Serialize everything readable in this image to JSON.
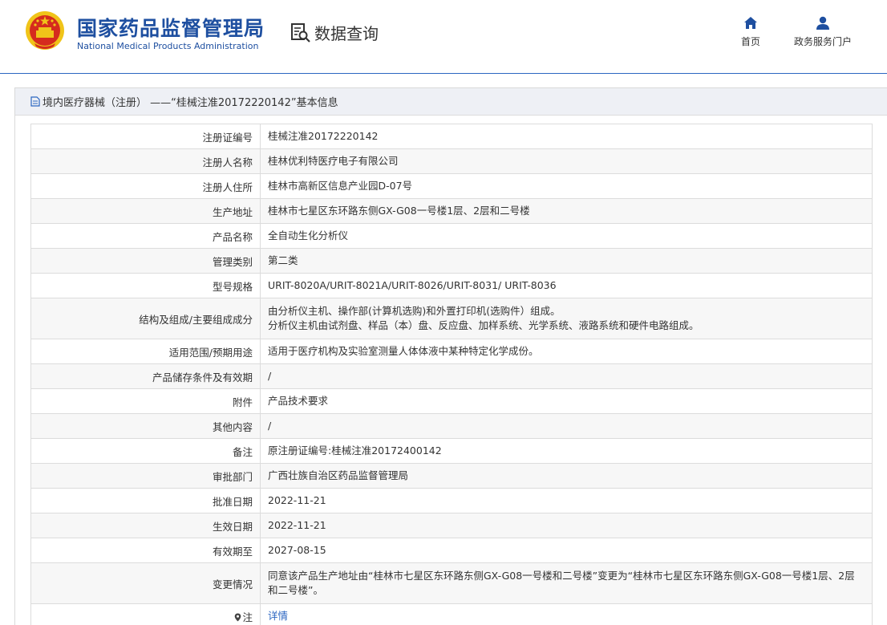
{
  "header": {
    "brand_cn": "国家药品监督管理局",
    "brand_en": "National Medical Products Administration",
    "query_label": "数据查询",
    "nav_home": "首页",
    "nav_portal": "政务服务门户"
  },
  "colors": {
    "brand": "#1e4fa0",
    "accent": "#2b66c1",
    "emblem_red": "#d52b1e",
    "emblem_gold": "#f0c419"
  },
  "panel": {
    "title": "境内医疗器械（注册） ——“桂械注准20172220142”基本信息"
  },
  "rows": [
    {
      "label": "注册证编号",
      "value": "桂械注准20172220142"
    },
    {
      "label": "注册人名称",
      "value": "桂林优利特医疗电子有限公司"
    },
    {
      "label": "注册人住所",
      "value": "桂林市高新区信息产业园D-07号"
    },
    {
      "label": "生产地址",
      "value": "桂林市七星区东环路东侧GX-G08一号楼1层、2层和二号楼"
    },
    {
      "label": "产品名称",
      "value": "全自动生化分析仪"
    },
    {
      "label": "管理类别",
      "value": "第二类"
    },
    {
      "label": "型号规格",
      "value": "URIT-8020A/URIT-8021A/URIT-8026/URIT-8031/ URIT-8036"
    },
    {
      "label": "结构及组成/主要组成成分",
      "value_line1": "由分析仪主机、操作部(计算机选购)和外置打印机(选购件）组成。",
      "value_line2": "分析仪主机由试剂盘、样品（本）盘、反应盘、加样系统、光学系统、液路系统和硬件电路组成。"
    },
    {
      "label": "适用范围/预期用途",
      "value": "适用于医疗机构及实验室测量人体体液中某种特定化学成份。"
    },
    {
      "label": "产品储存条件及有效期",
      "value": "/"
    },
    {
      "label": "附件",
      "value": "产品技术要求"
    },
    {
      "label": "其他内容",
      "value": "/"
    },
    {
      "label": "备注",
      "value": "原注册证编号:桂械注准20172400142"
    },
    {
      "label": "审批部门",
      "value": "广西壮族自治区药品监督管理局"
    },
    {
      "label": "批准日期",
      "value": "2022-11-21"
    },
    {
      "label": "生效日期",
      "value": "2022-11-21"
    },
    {
      "label": "有效期至",
      "value": "2027-08-15"
    },
    {
      "label": "变更情况",
      "value": "同意该产品生产地址由“桂林市七星区东环路东侧GX-G08一号楼和二号楼”变更为“桂林市七星区东环路东侧GX-G08一号楼1层、2层和二号楼”。"
    },
    {
      "label": "注",
      "value": "详情"
    }
  ]
}
